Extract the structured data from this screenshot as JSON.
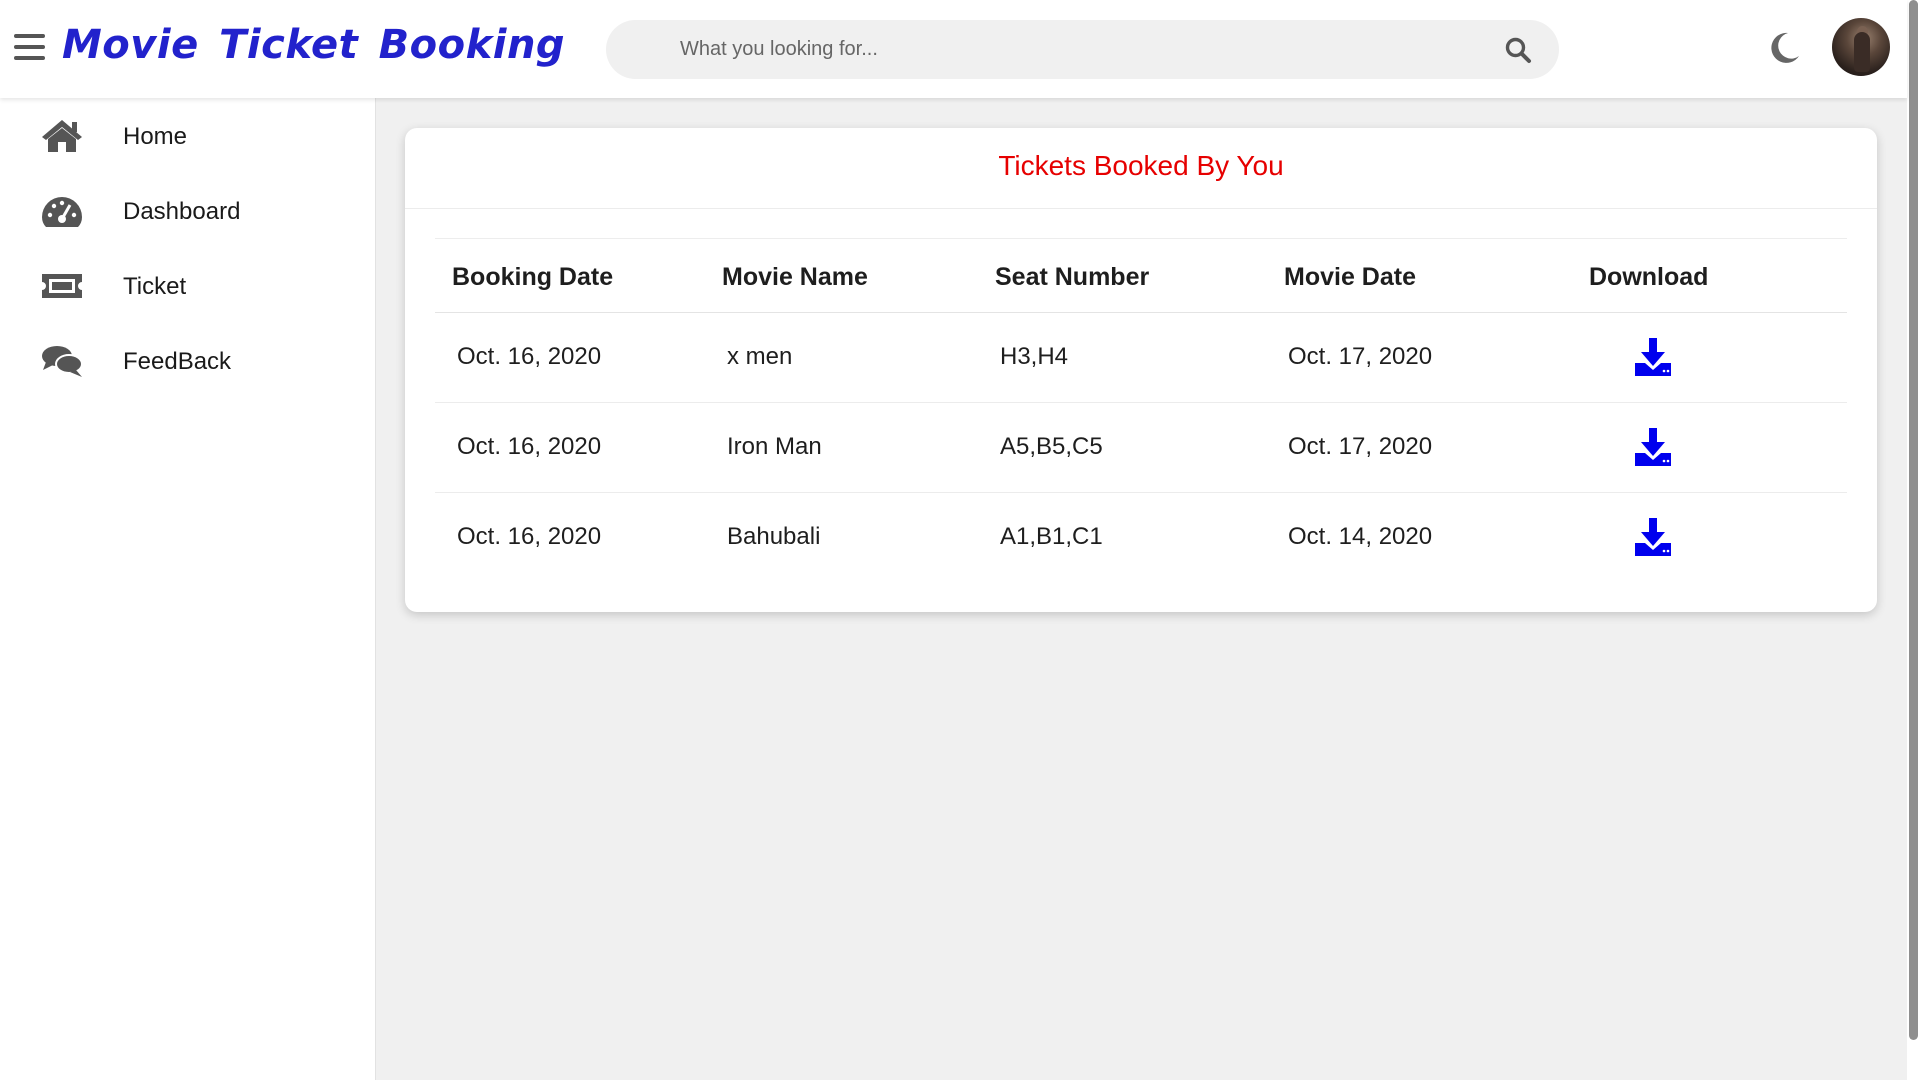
{
  "navbar": {
    "brand": "Movie Ticket Booking",
    "search_placeholder": "What you looking for...",
    "icons": [
      "menu-icon",
      "search-icon",
      "moon-icon",
      "avatar"
    ]
  },
  "sidebar": {
    "items": [
      {
        "label": "Home",
        "icon": "home-icon"
      },
      {
        "label": "Dashboard",
        "icon": "dashboard-icon"
      },
      {
        "label": "Ticket",
        "icon": "ticket-icon"
      },
      {
        "label": "FeedBack",
        "icon": "feedback-icon"
      }
    ]
  },
  "main": {
    "title": "Tickets Booked By You",
    "columns": [
      "Booking Date",
      "Movie Name",
      "Seat Number",
      "Movie Date",
      "Download"
    ],
    "rows": [
      {
        "booking_date": "Oct. 16, 2020",
        "movie_name": "x men",
        "seat_number": "H3,H4",
        "movie_date": "Oct. 17, 2020"
      },
      {
        "booking_date": "Oct. 16, 2020",
        "movie_name": "Iron Man",
        "seat_number": "A5,B5,C5",
        "movie_date": "Oct. 17, 2020"
      },
      {
        "booking_date": "Oct. 16, 2020",
        "movie_name": "Bahubali",
        "seat_number": "A1,B1,C1",
        "movie_date": "Oct. 14, 2020"
      }
    ]
  },
  "colors": {
    "brand": "#2222cc",
    "title": "#e60000",
    "download_icon": "#0000ee",
    "sidebar_icon": "#555555"
  }
}
